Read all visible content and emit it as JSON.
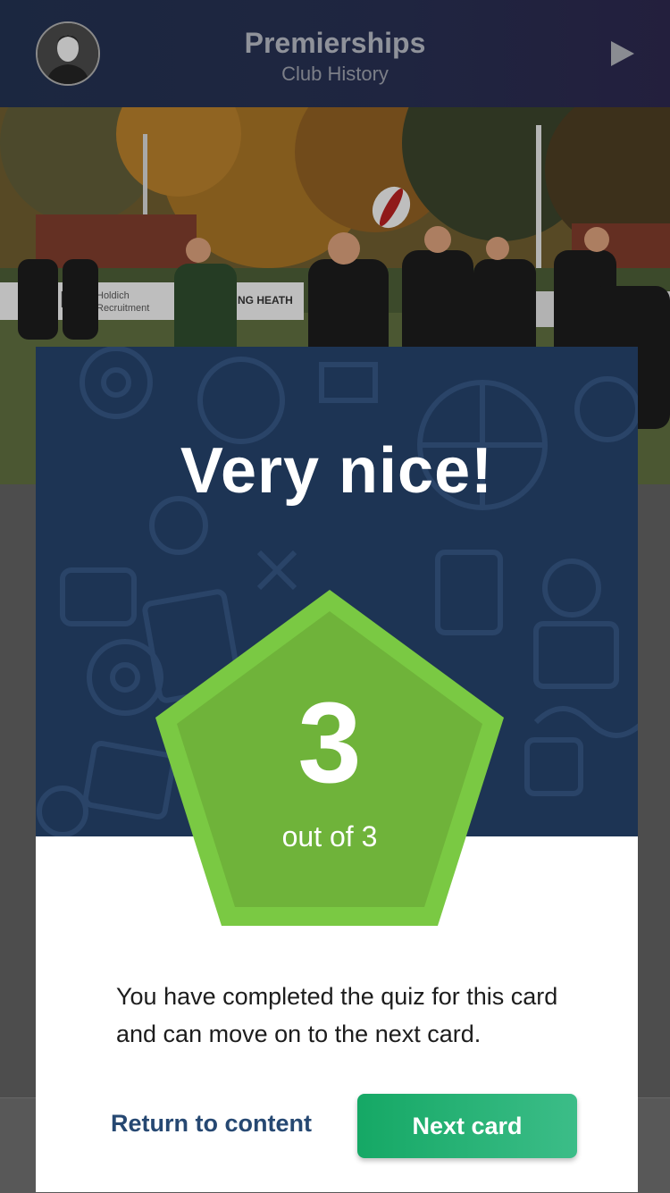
{
  "header": {
    "title": "Premierships",
    "subtitle": "Club History",
    "avatar_icon": "user-avatar",
    "play_icon": "play-icon"
  },
  "photo": {
    "sign_text_1": "HR",
    "sign_text_2": "Holdich",
    "sign_text_3": "Recruitment",
    "sign_text_4": "NG HEATH"
  },
  "modal": {
    "heading": "Very nice!",
    "score": "3",
    "score_sub": "out of 3",
    "message": "You have completed the quiz for this card and can move on to the next card.",
    "return_label": "Return to content",
    "next_label": "Next card"
  },
  "colors": {
    "modal_top": "#1d3454",
    "pentagon_outer": "#7ac943",
    "pentagon_inner": "#6fb33a",
    "next_button": "#15a865",
    "return_text": "#264872"
  }
}
